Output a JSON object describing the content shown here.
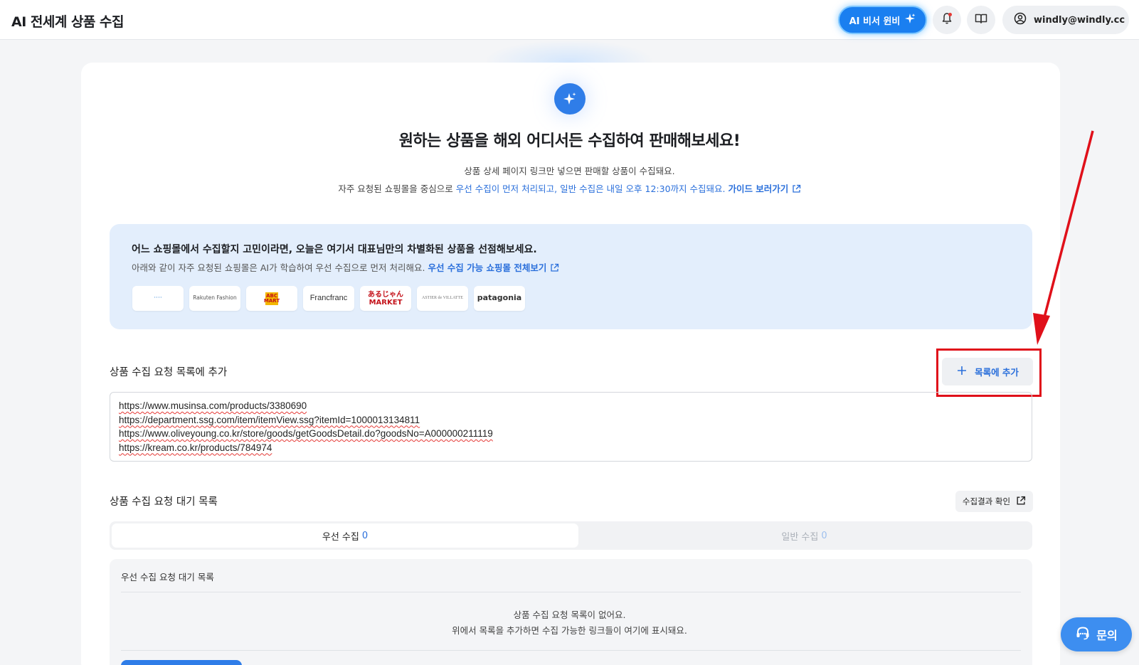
{
  "header": {
    "app_title": "AI 전세계 상품 수집",
    "ai_button_label": "AI 비서 윈비",
    "account_email": "windly@windly.cc"
  },
  "hero": {
    "title": "원하는 상품을 해외 어디서든 수집하여 판매해보세요!",
    "subtitle_line1": "상품 상세 페이지 링크만 넣으면 판매할 상품이 수집돼요.",
    "subtitle_line2_prefix": "자주 요청된 쇼핑몰을 중심으로",
    "subtitle_line2_highlight": "우선 수집이 먼저 처리되고, 일반 수집은 내일 오후 12:30까지 수집돼요.",
    "guide_link": "가이드 보러가기"
  },
  "recommend": {
    "title": "어느 쇼핑몰에서 수집할지 고민이라면, 오늘은 여기서 대표님만의 차별화된 상품을 선점해보세요.",
    "subtitle_prefix": "아래와 같이 자주 요청된 쇼핑몰은 AI가 학습하여 우선 수집으로 먼저 처리해요.",
    "subtitle_link": "우선 수집 가능 쇼핑몰 전체보기",
    "logos": [
      {
        "name": "logo-1",
        "text": "····"
      },
      {
        "name": "logo-rakuten-fashion",
        "text": "Rakuten Fashion"
      },
      {
        "name": "logo-abc-mart",
        "text": "ABC MART"
      },
      {
        "name": "logo-francfranc",
        "text": "Francfranc"
      },
      {
        "name": "logo-arujan-market",
        "text": "あるじゃん MARKET"
      },
      {
        "name": "logo-astier-de-villatte",
        "text": "ASTIER de VILLATTE"
      },
      {
        "name": "logo-patagonia",
        "text": "patagonia"
      }
    ]
  },
  "add_section": {
    "title": "상품 수집 요청 목록에 추가",
    "add_button_label": "목록에 추가",
    "urls": [
      "https://www.musinsa.com/products/3380690",
      "https://department.ssg.com/item/itemView.ssg?itemId=1000013134811",
      "https://www.oliveyoung.co.kr/store/goods/getGoodsDetail.do?goodsNo=A000000211119",
      "https://kream.co.kr/products/784974"
    ]
  },
  "wait_section": {
    "title": "상품 수집 요청 대기 목록",
    "result_button_label": "수집결과 확인",
    "tabs": [
      {
        "label": "우선 수집",
        "count": "0",
        "active": true
      },
      {
        "label": "일반 수집",
        "count": "0",
        "active": false
      }
    ],
    "list_title": "우선 수집 요청 대기 목록",
    "empty_line1": "상품 수집 요청 목록이 없어요.",
    "empty_line2": "위에서 목록을 추가하면 수집 가능한 링크들이 여기에 표시돼요."
  },
  "help_button_label": "문의",
  "colors": {
    "accent": "#2a6fdb",
    "highlight_annotation": "#e0101a"
  }
}
